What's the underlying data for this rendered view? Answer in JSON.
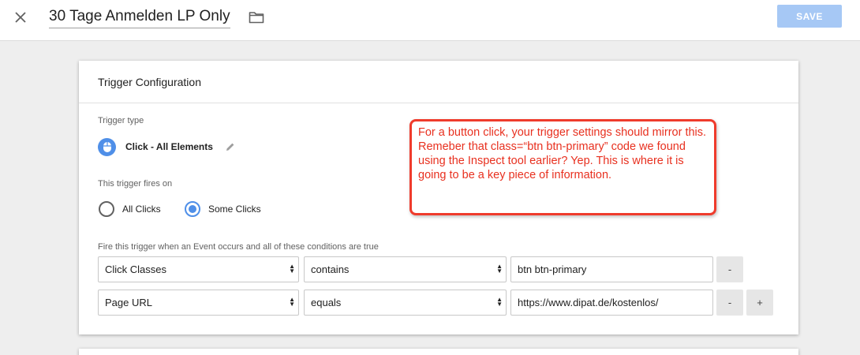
{
  "header": {
    "title": "30 Tage Anmelden LP Only",
    "save_label": "SAVE"
  },
  "card": {
    "title": "Trigger Configuration",
    "trigger_type_label": "Trigger type",
    "trigger_type_name": "Click - All Elements",
    "fires_on_label": "This trigger fires on",
    "option_all": "All Clicks",
    "option_some": "Some Clicks",
    "selected_option": "Some Clicks",
    "conditions_label": "Fire this trigger when an Event occurs and all of these conditions are true",
    "conditions": [
      {
        "variable": "Click Classes",
        "operator": "contains",
        "value": "btn btn-primary",
        "remove": "-"
      },
      {
        "variable": "Page URL",
        "operator": "equals",
        "value": "https://www.dipat.de/kostenlos/",
        "remove": "-",
        "add": "+"
      }
    ]
  },
  "annotation": {
    "text": "For a button click, your trigger settings should mirror this. Remeber that class=“btn btn-primary” code we found using the Inspect tool earlier? Yep. This is where it is going to be a key piece of information."
  },
  "icons": {
    "close": "close-icon",
    "folder": "folder-icon",
    "trigger_type": "mouse-icon",
    "edit": "pencil-icon"
  },
  "colors": {
    "accent": "#4f8fe8",
    "save_button": "#a6c8f5",
    "annotation": "#e8301f",
    "background": "#eeeeee"
  }
}
